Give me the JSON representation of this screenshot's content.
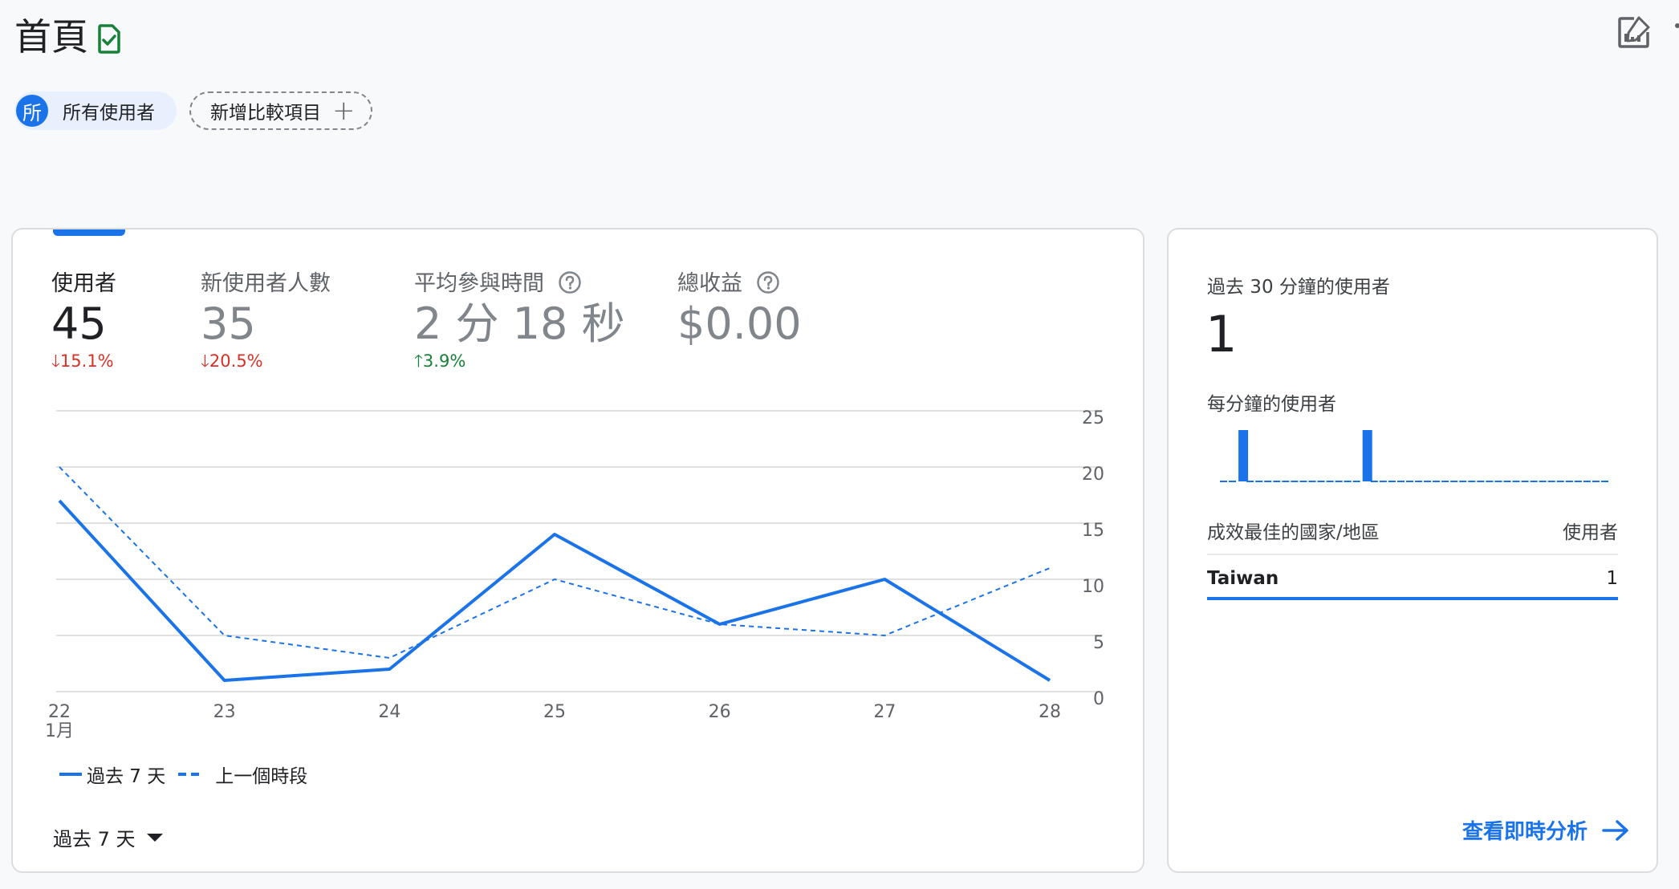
{
  "header": {
    "title": "首頁",
    "verified_icon": "check-document-icon",
    "edit_icon": "edit-chart-icon"
  },
  "chips": {
    "user_avatar": "所",
    "user_label": "所有使用者",
    "add_compare_label": "新增比較項目",
    "add_compare_plus": "+"
  },
  "metrics": [
    {
      "label": "使用者",
      "value": "45",
      "delta": "15.1%",
      "direction": "down"
    },
    {
      "label": "新使用者人數",
      "value": "35",
      "delta": "20.5%",
      "direction": "down"
    },
    {
      "label": "平均參與時間",
      "value": "2 分 18 秒",
      "delta": "3.9%",
      "direction": "up"
    },
    {
      "label": "總收益",
      "value": "$0.00"
    }
  ],
  "colors": {
    "accent": "#1a73e8",
    "down": "#d93025",
    "up": "#188038"
  },
  "chart_data": {
    "type": "line",
    "categories": [
      "22",
      "23",
      "24",
      "25",
      "26",
      "27",
      "28"
    ],
    "x_sublabel": "1月",
    "yticks": [
      "25",
      "20",
      "15",
      "10",
      "5",
      "0"
    ],
    "ylim": [
      0,
      25
    ],
    "grid": true,
    "legend_position": "bottom-left",
    "series": [
      {
        "name": "過去 7 天",
        "style": "solid",
        "values": [
          17,
          1,
          2,
          14,
          6,
          10,
          1
        ]
      },
      {
        "name": "上一個時段",
        "style": "dashed",
        "values": [
          20,
          5,
          3,
          10,
          6,
          5,
          11
        ]
      }
    ]
  },
  "footer": {
    "period_label": "過去 7 天"
  },
  "realtime": {
    "title": "過去 30 分鐘的使用者",
    "value": "1",
    "per_minute_label": "每分鐘的使用者",
    "per_minute_values": [
      0,
      0,
      1,
      0,
      0,
      0,
      0,
      0,
      0,
      0,
      0,
      0,
      0,
      0,
      0,
      0,
      1,
      0,
      0,
      0,
      0,
      0,
      0,
      0,
      0,
      0,
      0,
      0,
      0,
      0,
      0,
      0,
      0,
      0,
      0,
      0,
      0,
      0,
      0,
      0,
      0,
      0,
      0,
      0
    ],
    "table_header_country": "成效最佳的國家/地區",
    "table_header_users": "使用者",
    "rows": [
      {
        "country": "Taiwan",
        "users": "1"
      }
    ],
    "link_label": "查看即時分析",
    "link_icon": "arrow-right-icon"
  }
}
